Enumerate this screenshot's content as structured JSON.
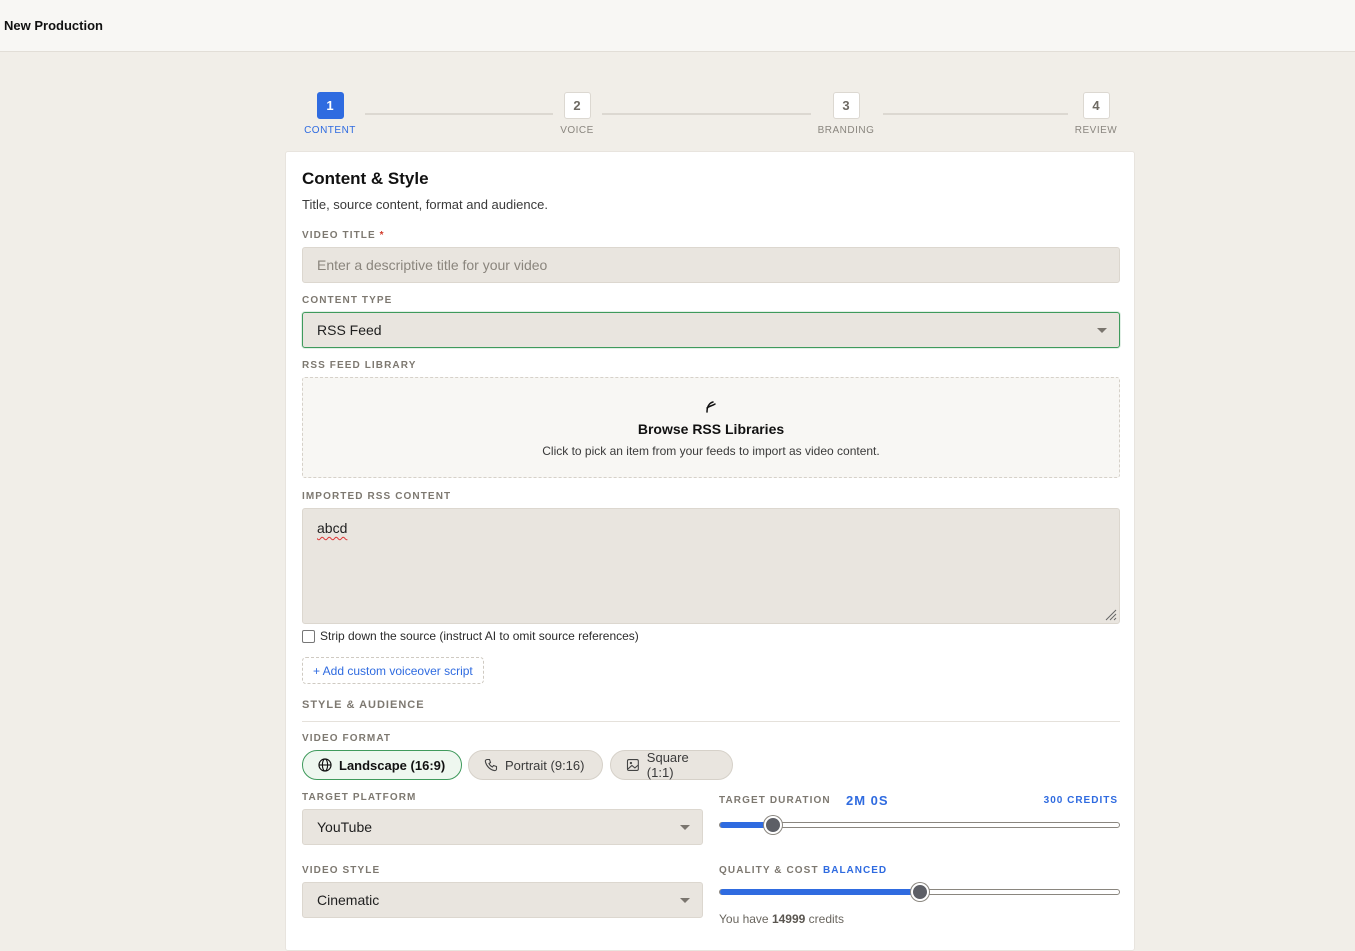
{
  "topbar": {
    "title": "New Production"
  },
  "stepper": [
    {
      "num": "1",
      "label": "CONTENT",
      "active": true
    },
    {
      "num": "2",
      "label": "VOICE",
      "active": false
    },
    {
      "num": "3",
      "label": "BRANDING",
      "active": false
    },
    {
      "num": "4",
      "label": "REVIEW",
      "active": false
    }
  ],
  "card": {
    "title": "Content & Style",
    "subtitle": "Title, source content, format and audience."
  },
  "video_title": {
    "label": "VIDEO TITLE",
    "required": "*",
    "placeholder": "Enter a descriptive title for your video",
    "value": ""
  },
  "content_type": {
    "label": "CONTENT TYPE",
    "value": "RSS Feed"
  },
  "rss_library": {
    "label": "RSS FEED LIBRARY",
    "icon": "rss-icon",
    "title": "Browse RSS Libraries",
    "description": "Click to pick an item from your feeds to import as video content."
  },
  "imported": {
    "label": "IMPORTED RSS CONTENT",
    "value": "abcd"
  },
  "strip": {
    "label": "Strip down the source (instruct AI to omit source references)",
    "checked": false
  },
  "add_script": {
    "label": "+ Add custom voiceover script"
  },
  "style_section": {
    "label": "STYLE & AUDIENCE"
  },
  "video_format": {
    "label": "VIDEO FORMAT",
    "options": [
      {
        "label": "Landscape (16:9)",
        "icon": "globe-icon",
        "selected": true
      },
      {
        "label": "Portrait (9:16)",
        "icon": "phone-icon",
        "selected": false
      },
      {
        "label": "Square (1:1)",
        "icon": "image-icon",
        "selected": false
      }
    ]
  },
  "target_platform": {
    "label": "TARGET PLATFORM",
    "value": "YouTube"
  },
  "target_duration": {
    "label": "TARGET DURATION",
    "value": "2M 0S",
    "credits": "300 CREDITS",
    "fraction": 0.135
  },
  "video_style": {
    "label": "VIDEO STYLE",
    "value": "Cinematic"
  },
  "quality": {
    "label": "QUALITY & COST",
    "value": "BALANCED",
    "fraction": 0.5
  },
  "balance": {
    "prefix": "You have",
    "amount": "14999",
    "suffix": "credits"
  },
  "colors": {
    "accent": "#2f6be0",
    "success": "#3f9a5c",
    "background": "#f1eee8"
  }
}
